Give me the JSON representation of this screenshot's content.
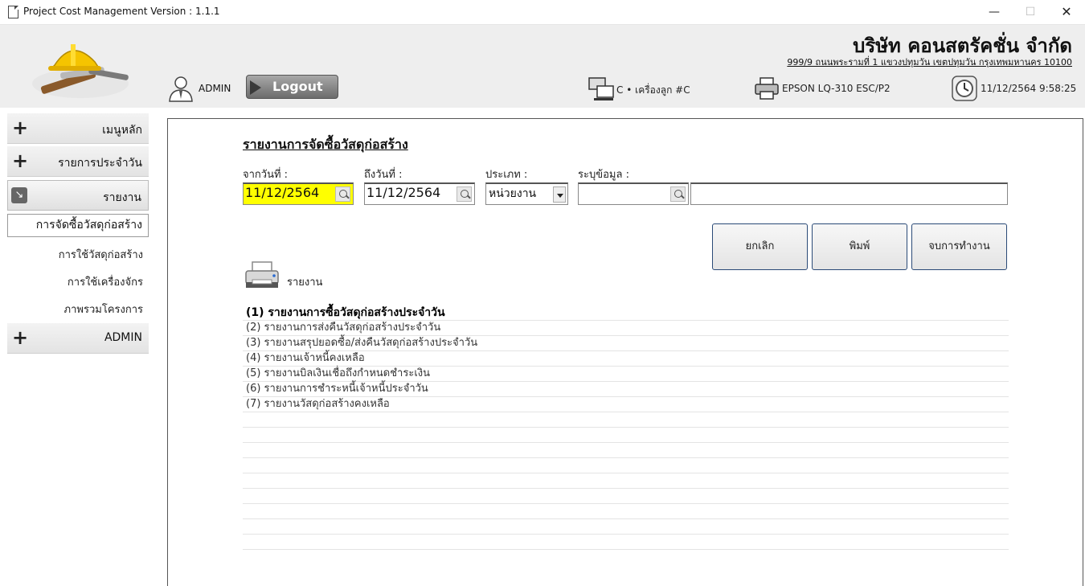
{
  "window": {
    "title": "Project Cost Management Version : 1.1.1",
    "min": "—",
    "max": "☐",
    "close": "✕"
  },
  "header": {
    "company_name": "บริษัท คอนสตรัคชั่น จำกัด",
    "company_address": "999/9 ถนนพระรามที่ 1 แขวงปทุมวัน เขตปทุมวัน กรุงเทพมหานคร 10100",
    "user": "ADMIN",
    "logout": "Logout",
    "machine": "C • เครื่องลูก #C",
    "printer": "EPSON LQ-310 ESC/P2",
    "datetime": "11/12/2564 9:58:25"
  },
  "sidebar": {
    "main_menu": "เมนูหลัก",
    "daily": "รายการประจำวัน",
    "report": "รายงาน",
    "sub_active": "การจัดซื้อวัสดุก่อสร้าง",
    "sub_items": [
      "การใช้วัสดุก่อสร้าง",
      "การใช้เครื่องจักร",
      "ภาพรวมโครงการ"
    ],
    "admin": "ADMIN"
  },
  "form": {
    "title": "รายงานการจัดซื้อวัสดุก่อสร้าง",
    "from_label": "จากวันที่ :",
    "from_value": "11/12/2564",
    "to_label": "ถึงวันที่ :",
    "to_value": "11/12/2564",
    "type_label": "ประเภท :",
    "type_value": "หน่วยงาน",
    "spec_label": "ระบุข้อมูล :",
    "spec_code": "",
    "spec_name": ""
  },
  "buttons": {
    "cancel": "ยกเลิก",
    "print": "พิมพ์",
    "exit": "จบการทำงาน"
  },
  "reports": {
    "label": "รายงาน",
    "items": [
      "(1) รายงานการซื้อวัสดุก่อสร้างประจำวัน",
      "(2) รายงานการส่งคืนวัสดุก่อสร้างประจำวัน",
      "(3) รายงานสรุปยอดซื้อ/ส่งคืนวัสดุก่อสร้างประจำวัน",
      "(4) รายงานเจ้าหนี้คงเหลือ",
      "(5) รายงานบิลเงินเชื่อถึงกำหนดชำระเงิน",
      "(6) รายงานการชำระหนี้เจ้าหนี้ประจำวัน",
      "(7) รายงานวัสดุก่อสร้างคงเหลือ",
      "",
      "",
      "",
      "",
      "",
      "",
      "",
      "",
      ""
    ]
  }
}
